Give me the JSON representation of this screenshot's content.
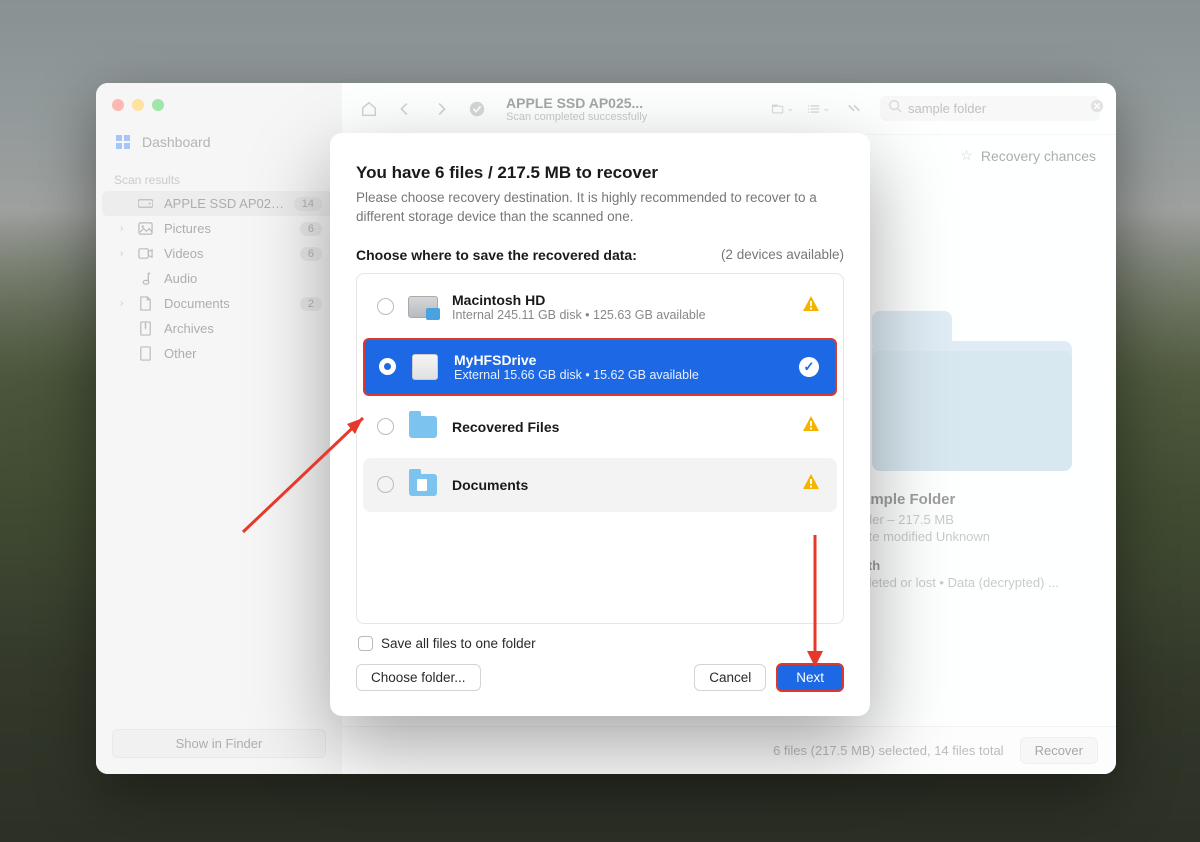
{
  "sidebar": {
    "dashboard": "Dashboard",
    "section_label": "Scan results",
    "items": [
      {
        "label": "APPLE SSD AP025...",
        "badge": "14",
        "icon": "disk",
        "has_children": false,
        "selected": true
      },
      {
        "label": "Pictures",
        "badge": "6",
        "icon": "picture",
        "has_children": true
      },
      {
        "label": "Videos",
        "badge": "6",
        "icon": "video",
        "has_children": true
      },
      {
        "label": "Audio",
        "badge": "",
        "icon": "audio",
        "has_children": false
      },
      {
        "label": "Documents",
        "badge": "2",
        "icon": "document",
        "has_children": true
      },
      {
        "label": "Archives",
        "badge": "",
        "icon": "archive",
        "has_children": false
      },
      {
        "label": "Other",
        "badge": "",
        "icon": "other",
        "has_children": false
      }
    ],
    "show_in_finder": "Show in Finder"
  },
  "toolbar": {
    "title": "APPLE SSD AP025...",
    "subtitle": "Scan completed successfully",
    "search_placeholder": "sample folder"
  },
  "recovery_chances_label": "Recovery chances",
  "preview": {
    "name": "Sample Folder",
    "kind_line": "Older – 217.5 MB",
    "modified_line": "Date modified  Unknown",
    "path_head": "Path",
    "path_line": "Deleted or lost • Data (decrypted) ..."
  },
  "status": {
    "summary": "6 files (217.5 MB) selected, 14 files total",
    "recover": "Recover"
  },
  "modal": {
    "title": "You have 6 files / 217.5 MB to recover",
    "description": "Please choose recovery destination. It is highly recommended to recover to a different storage device than the scanned one.",
    "choose_label": "Choose where to save the recovered data:",
    "devices_available": "(2 devices available)",
    "destinations": [
      {
        "name": "Macintosh HD",
        "sub": "Internal 245.11 GB disk • 125.63 GB available",
        "icon": "hdd",
        "state": "warn"
      },
      {
        "name": "MyHFSDrive",
        "sub": "External 15.66 GB disk • 15.62 GB available",
        "icon": "external",
        "state": "selected"
      },
      {
        "name": "Recovered Files",
        "sub": "",
        "icon": "folder",
        "state": "warn"
      },
      {
        "name": "Documents",
        "sub": "",
        "icon": "folder-doc",
        "state": "warn"
      }
    ],
    "save_all_label": "Save all files to one folder",
    "choose_folder": "Choose folder...",
    "cancel": "Cancel",
    "next": "Next"
  }
}
